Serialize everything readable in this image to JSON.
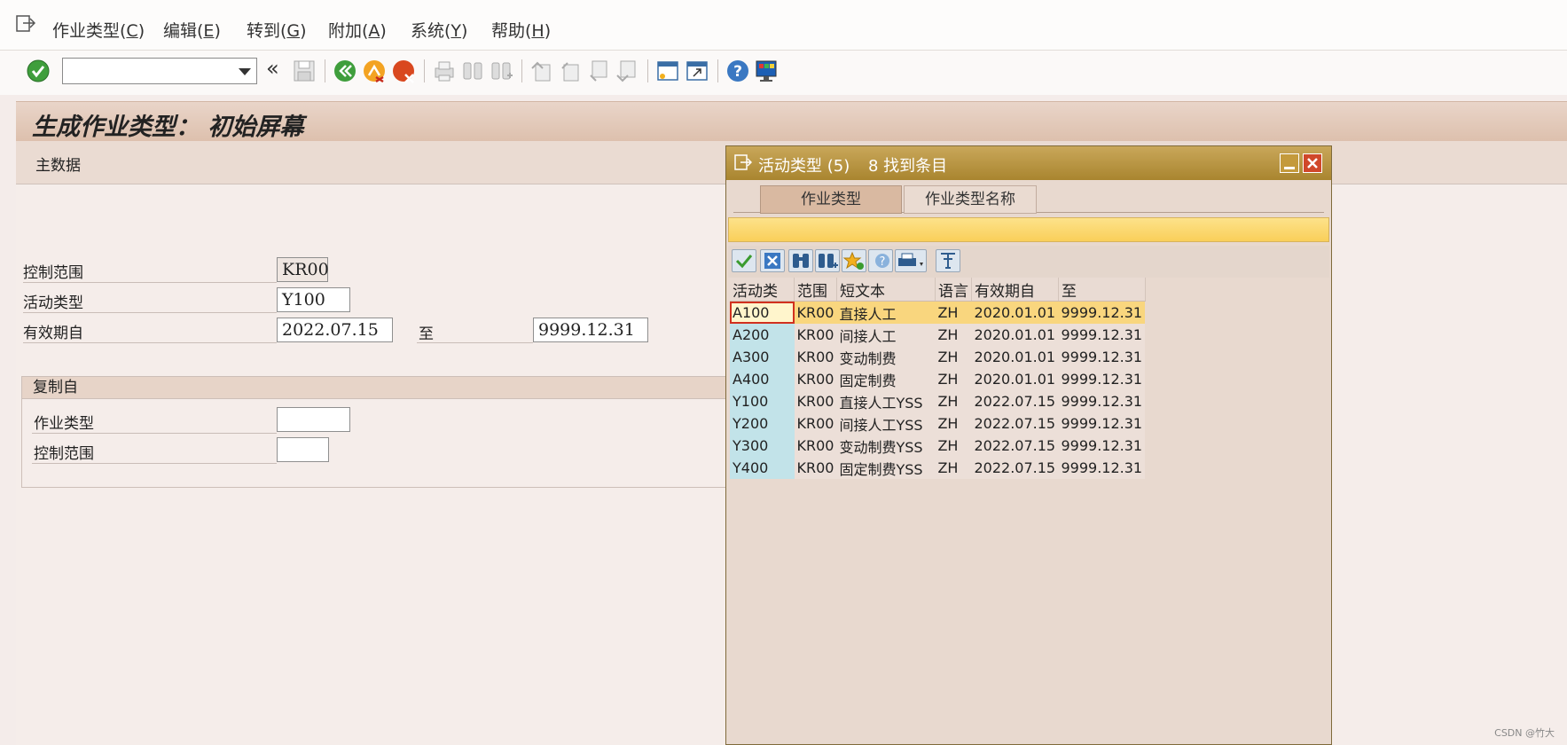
{
  "menu": {
    "items": [
      {
        "text": "作业类型(",
        "key": "C",
        "end": ")"
      },
      {
        "text": "编辑(",
        "key": "E",
        "end": ")"
      },
      {
        "text": "转到(",
        "key": "G",
        "end": ")"
      },
      {
        "text": "附加(",
        "key": "A",
        "end": ")"
      },
      {
        "text": "系统(",
        "key": "Y",
        "end": ")"
      },
      {
        "text": "帮助(",
        "key": "H",
        "end": ")"
      }
    ]
  },
  "toolbar": {
    "command_value": "",
    "back_chevrons": "«"
  },
  "page": {
    "title": "生成作业类型： 初始屏幕",
    "section_label": "主数据"
  },
  "form": {
    "controlling_area_label": "控制范围",
    "controlling_area_value": "KR00",
    "activity_type_label": "活动类型",
    "activity_type_value": "Y100",
    "valid_from_label": "有效期自",
    "valid_from_value": "2022.07.15",
    "to_label": "至",
    "to_value": "9999.12.31"
  },
  "copy_from": {
    "title": "复制自",
    "activity_type_label": "作业类型",
    "activity_type_value": "",
    "controlling_area_label": "控制范围",
    "controlling_area_value": ""
  },
  "popup": {
    "title": "活动类型 (5)",
    "count": "8 找到条目",
    "tabs": [
      "作业类型",
      "作业类型名称"
    ],
    "columns": [
      "活动类",
      "范围",
      "短文本",
      "语言",
      "有效期自",
      "至"
    ],
    "rows": [
      [
        "A100",
        "KR00",
        "直接人工",
        "ZH",
        "2020.01.01",
        "9999.12.31"
      ],
      [
        "A200",
        "KR00",
        "间接人工",
        "ZH",
        "2020.01.01",
        "9999.12.31"
      ],
      [
        "A300",
        "KR00",
        "变动制费",
        "ZH",
        "2020.01.01",
        "9999.12.31"
      ],
      [
        "A400",
        "KR00",
        "固定制费",
        "ZH",
        "2020.01.01",
        "9999.12.31"
      ],
      [
        "Y100",
        "KR00",
        "直接人工YSS",
        "ZH",
        "2022.07.15",
        "9999.12.31"
      ],
      [
        "Y200",
        "KR00",
        "间接人工YSS",
        "ZH",
        "2022.07.15",
        "9999.12.31"
      ],
      [
        "Y300",
        "KR00",
        "变动制费YSS",
        "ZH",
        "2022.07.15",
        "9999.12.31"
      ],
      [
        "Y400",
        "KR00",
        "固定制费YSS",
        "ZH",
        "2022.07.15",
        "9999.12.31"
      ]
    ]
  },
  "watermark": "CSDN @竹大"
}
